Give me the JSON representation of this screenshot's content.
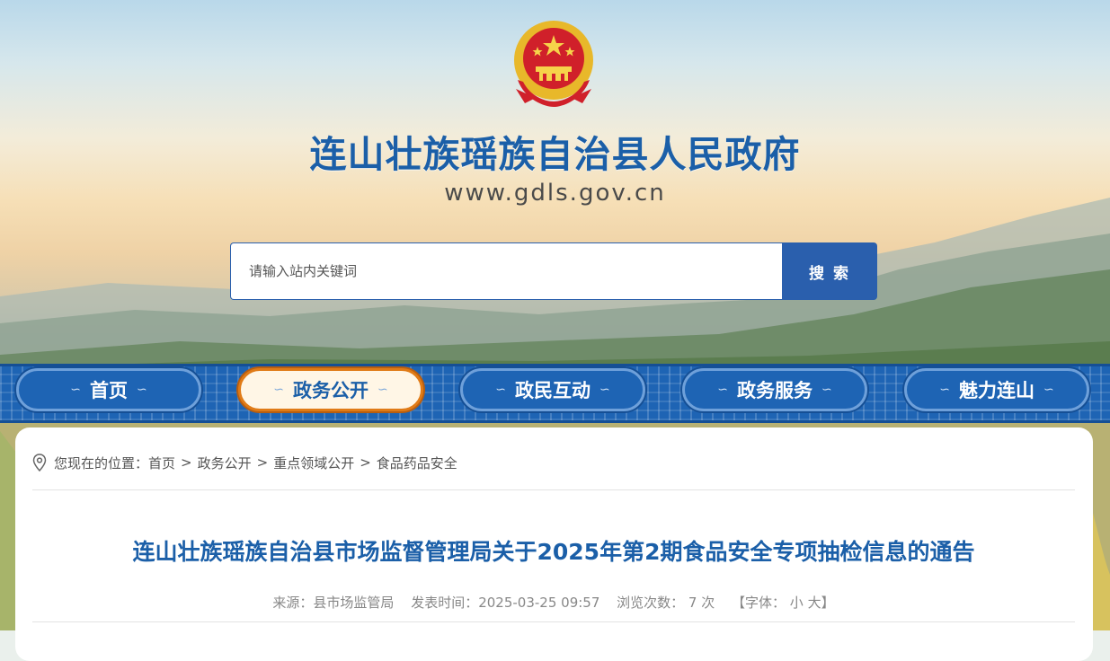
{
  "site": {
    "title": "连山壮族瑶族自治县人民政府",
    "url": "www.gdls.gov.cn"
  },
  "search": {
    "placeholder": "请输入站内关键词",
    "button_label": "搜 索"
  },
  "nav": {
    "items": [
      {
        "label": "首页",
        "active": false
      },
      {
        "label": "政务公开",
        "active": true
      },
      {
        "label": "政民互动",
        "active": false
      },
      {
        "label": "政务服务",
        "active": false
      },
      {
        "label": "魅力连山",
        "active": false
      }
    ],
    "wave_glyph": "∽"
  },
  "breadcrumb": {
    "prefix": "您现在的位置：",
    "items": [
      "首页",
      "政务公开",
      "重点领域公开",
      "食品药品安全"
    ],
    "separator": ">"
  },
  "article": {
    "title": "连山壮族瑶族自治县市场监督管理局关于2025年第2期食品安全专项抽检信息的通告",
    "source": "来源：县市场监管局",
    "publish_time": "发表时间：2025-03-25 09:57",
    "views": "浏览次数： 7 次",
    "font_size_label": "【字体： 小 大】"
  },
  "colors": {
    "brand_blue": "#1b5fa8",
    "nav_blue": "#1e64b4",
    "active_orange": "#e07b17"
  }
}
